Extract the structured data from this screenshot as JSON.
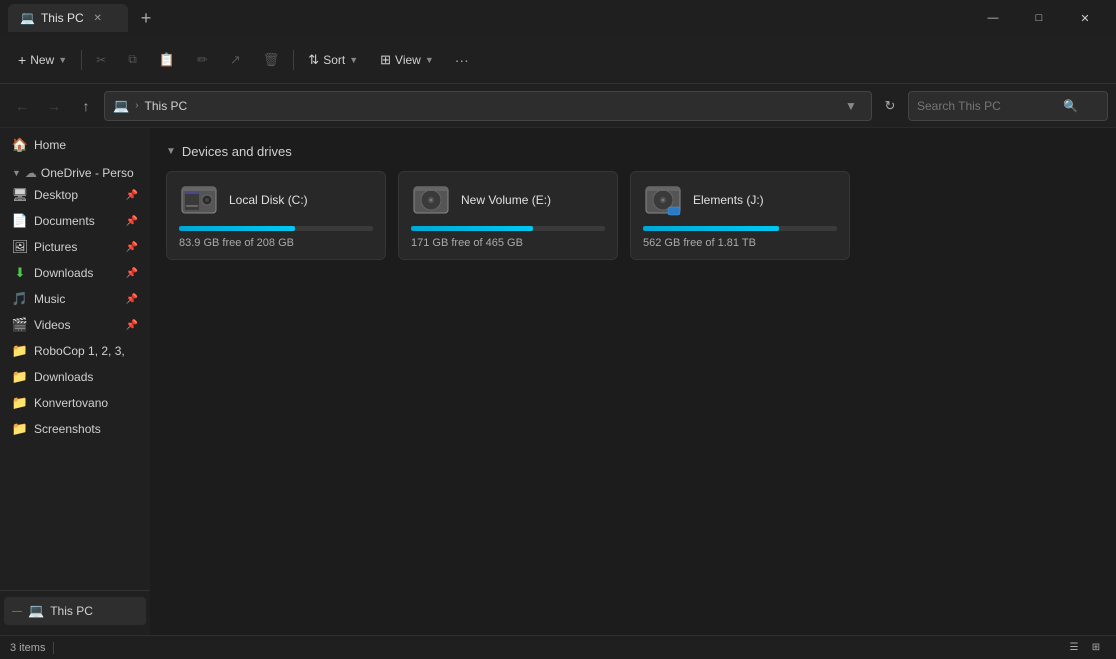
{
  "titlebar": {
    "tab_label": "This PC",
    "new_tab_label": "+"
  },
  "toolbar": {
    "new_label": "New",
    "cut_icon": "✂",
    "copy_icon": "⧉",
    "paste_icon": "📋",
    "rename_icon": "✏",
    "share_icon": "↗",
    "delete_icon": "🗑",
    "sort_label": "Sort",
    "view_label": "View",
    "more_icon": "···"
  },
  "navbar": {
    "back_icon": "←",
    "forward_icon": "→",
    "up_icon": "↑",
    "address_icon": "💻",
    "address_label": "This PC",
    "refresh_icon": "↻",
    "search_placeholder": "Search This PC"
  },
  "sidebar": {
    "sections": [
      {
        "label": "OneDrive - Perso",
        "icon": "☁",
        "pinned": false,
        "expanded": true
      }
    ],
    "items": [
      {
        "id": "desktop",
        "label": "Desktop",
        "icon": "🖥",
        "pinned": true
      },
      {
        "id": "documents",
        "label": "Documents",
        "icon": "📄",
        "pinned": true
      },
      {
        "id": "pictures",
        "label": "Pictures",
        "icon": "🖼",
        "pinned": true
      },
      {
        "id": "downloads-pinned",
        "label": "Downloads",
        "icon": "⬇",
        "pinned": true
      },
      {
        "id": "music",
        "label": "Music",
        "icon": "♫",
        "pinned": true
      },
      {
        "id": "videos",
        "label": "Videos",
        "icon": "🎬",
        "pinned": true
      },
      {
        "id": "robocop",
        "label": "RoboCop 1, 2, 3,",
        "icon": "📁",
        "pinned": false
      },
      {
        "id": "downloads2",
        "label": "Downloads",
        "icon": "📁",
        "pinned": false
      },
      {
        "id": "konvertovano",
        "label": "Konvertovano",
        "icon": "📁",
        "pinned": false
      },
      {
        "id": "screenshots",
        "label": "Screenshots",
        "icon": "📁",
        "pinned": false
      }
    ],
    "footer": {
      "label": "This PC",
      "icon": "💻",
      "toggle": "—"
    }
  },
  "content": {
    "section_title": "Devices and drives",
    "drives": [
      {
        "name": "Local Disk (C:)",
        "free": "83.9 GB free of 208 GB",
        "used_pct": 60,
        "type": "system"
      },
      {
        "name": "New Volume (E:)",
        "free": "171 GB free of 465 GB",
        "used_pct": 63,
        "type": "data"
      },
      {
        "name": "Elements (J:)",
        "free": "562 GB free of 1.81 TB",
        "used_pct": 70,
        "type": "external"
      }
    ]
  },
  "statusbar": {
    "items_label": "3 items"
  },
  "colors": {
    "progress_fill": "#00b8d9",
    "progress_bg": "#3a3a3a"
  }
}
